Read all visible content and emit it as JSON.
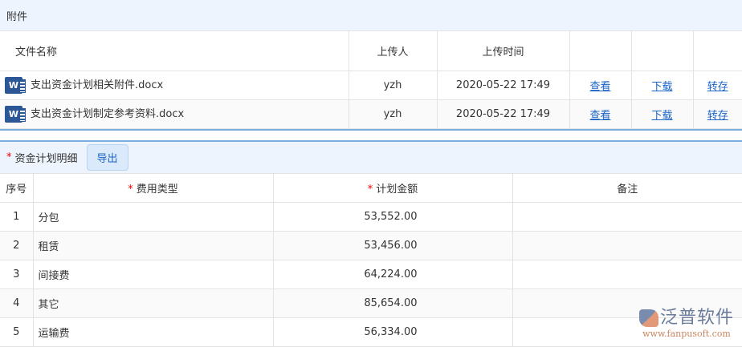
{
  "attachments": {
    "title": "附件",
    "headers": [
      "文件名称",
      "上传人",
      "上传时间",
      "",
      "",
      ""
    ],
    "rows": [
      {
        "name": "支出资金计划相关附件.docx",
        "uploader": "yzh",
        "time": "2020-05-22 17:49",
        "view": "查看",
        "download": "下载",
        "transfer": "转存"
      },
      {
        "name": "支出资金计划制定参考资料.docx",
        "uploader": "yzh",
        "time": "2020-05-22 17:49",
        "view": "查看",
        "download": "下载",
        "transfer": "转存"
      }
    ]
  },
  "detail": {
    "title": "资金计划明细",
    "export": "导出",
    "required_mark": "*",
    "headers": [
      "序号",
      "费用类型",
      "计划金额",
      "备注"
    ],
    "rows": [
      {
        "no": "1",
        "type": "分包",
        "amount": "53,552.00",
        "note": ""
      },
      {
        "no": "2",
        "type": "租赁",
        "amount": "53,456.00",
        "note": ""
      },
      {
        "no": "3",
        "type": "间接费",
        "amount": "64,224.00",
        "note": ""
      },
      {
        "no": "4",
        "type": "其它",
        "amount": "85,654.00",
        "note": ""
      },
      {
        "no": "5",
        "type": "运输费",
        "amount": "56,334.00",
        "note": ""
      }
    ]
  },
  "logo": {
    "name": "泛普软件",
    "url": "www.fanpusoft.com"
  },
  "icons": {
    "file": "W"
  }
}
